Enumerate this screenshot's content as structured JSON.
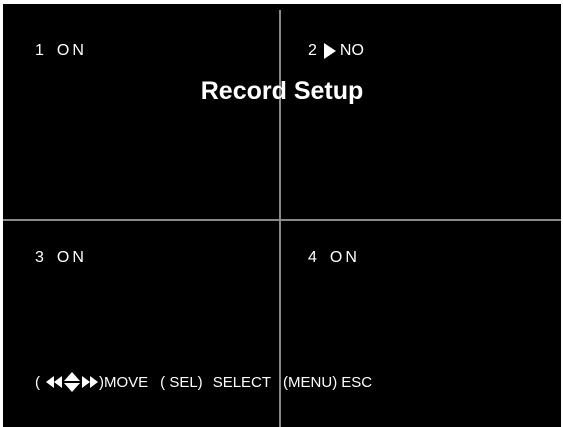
{
  "title": "Record Setup",
  "channels": [
    {
      "number": "1",
      "status": "ON"
    },
    {
      "number": "2",
      "status": "NO"
    },
    {
      "number": "3",
      "status": "ON"
    },
    {
      "number": "4",
      "status": "ON"
    }
  ],
  "help": {
    "open_paren": "(",
    "arrow_icons": "left-left-updown-right-right-arrows-icon",
    "move": ")MOVE",
    "sel_key": "( SEL)",
    "select": "SELECT",
    "menu_key": "(MENU)",
    "esc": "ESC"
  },
  "colors": {
    "background": "#000000",
    "text": "#ffffff",
    "divider": "#8a8a8a"
  }
}
